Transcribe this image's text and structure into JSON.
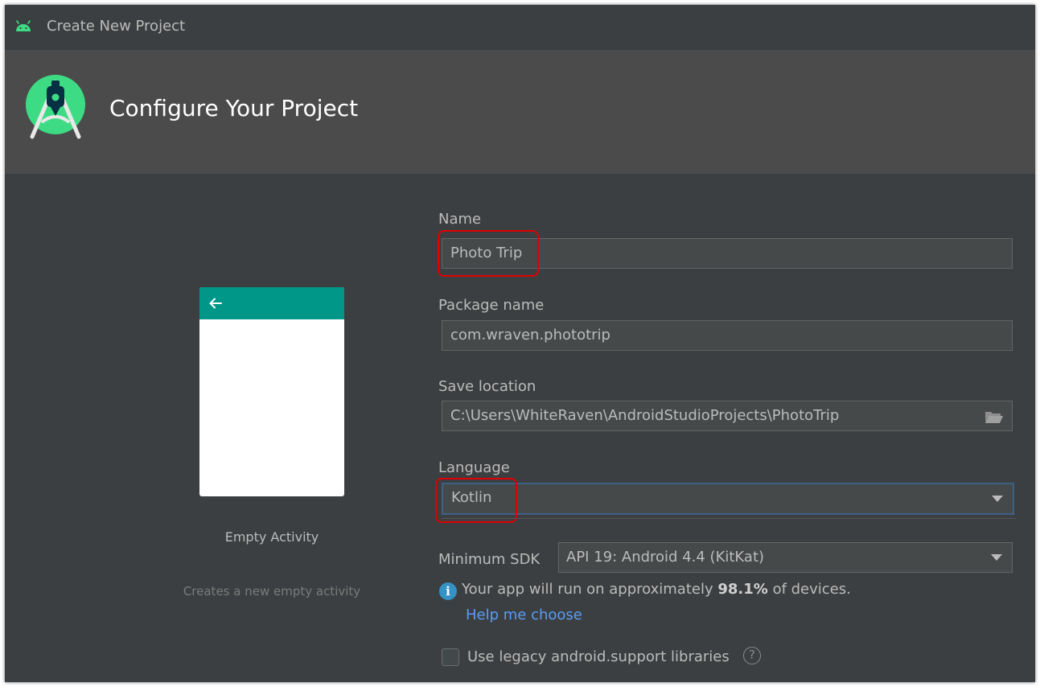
{
  "window": {
    "title": "Create New Project"
  },
  "banner": {
    "heading": "Configure Your Project"
  },
  "preview": {
    "template_name": "Empty Activity",
    "template_description": "Creates a new empty activity"
  },
  "form": {
    "name_label": "Name",
    "name_value": "Photo Trip",
    "package_label": "Package name",
    "package_value": "com.wraven.phototrip",
    "save_location_label": "Save location",
    "save_location_value": "C:\\Users\\WhiteRaven\\AndroidStudioProjects\\PhotoTrip",
    "language_label": "Language",
    "language_value": "Kotlin",
    "min_sdk_label": "Minimum SDK",
    "min_sdk_value": "API 19: Android 4.4 (KitKat)",
    "info_prefix": "Your app will run on approximately",
    "info_percent": "98.1%",
    "info_suffix": "of devices.",
    "help_link": "Help me choose",
    "legacy_checkbox_label": "Use legacy android.support libraries",
    "legacy_checkbox_checked": false
  },
  "icons": {
    "title": "android-icon",
    "banner": "android-studio-logo",
    "preview_back": "back-arrow-icon",
    "save_location": "folder-icon",
    "dropdown": "chevron-down-icon",
    "info": "info-icon",
    "help": "help-icon"
  },
  "colors": {
    "window_bg": "#3c3f41",
    "banner_bg": "#4b4b4b",
    "field_bg": "#45494a",
    "focus_border": "#3d6185",
    "link": "#589df6",
    "annotation": "#e00000",
    "app_bar": "#009688",
    "android_green": "#3ddc84"
  }
}
